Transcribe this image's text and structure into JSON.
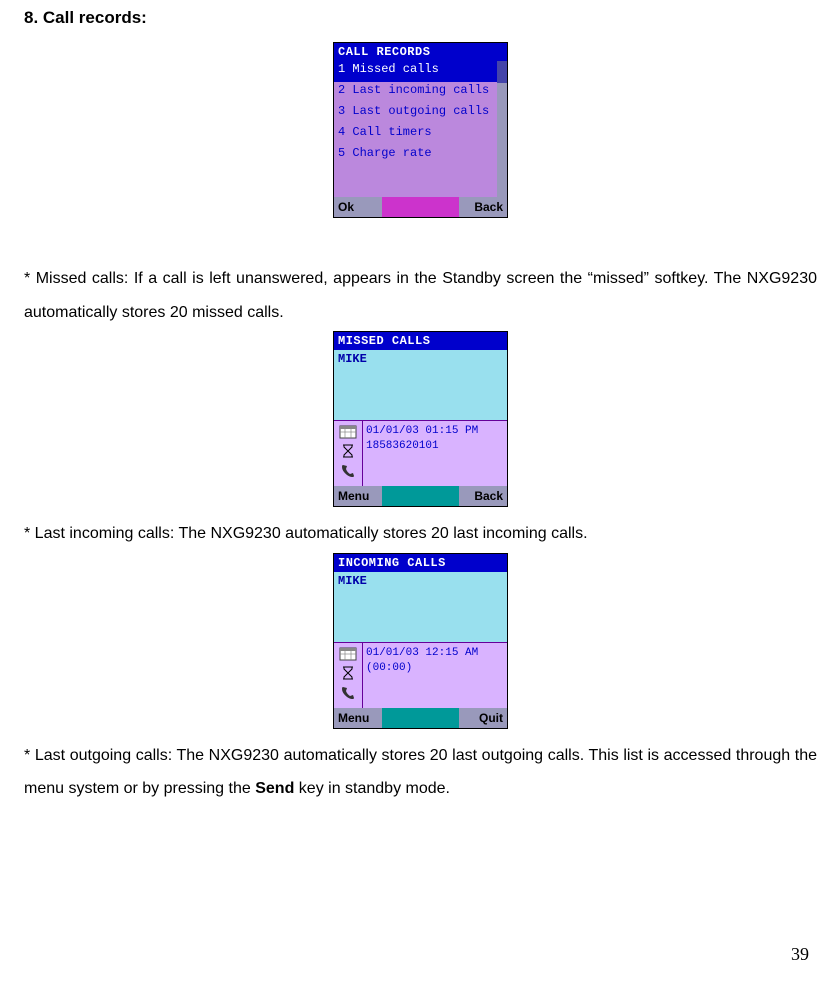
{
  "heading": "8. Call records:",
  "screen1": {
    "title": "CALL RECORDS",
    "items": [
      "1 Missed calls",
      "2 Last incoming calls",
      "3 Last outgoing calls",
      "4 Call timers",
      "5 Charge rate"
    ],
    "softLeft": "Ok",
    "softRight": "Back"
  },
  "para1_part1": "* Missed calls: If a call is left unanswered, appears in the Standby screen the “missed” softkey. The NXG9230 automatically stores 20 missed calls.",
  "screen2": {
    "title": "MISSED CALLS",
    "caller": "MIKE",
    "line1": "01/01/03 01:15 PM",
    "line2": "18583620101",
    "softLeft": "Menu",
    "softRight": "Back"
  },
  "para2": "* Last incoming calls: The NXG9230 automatically stores 20 last incoming calls.",
  "screen3": {
    "title": "INCOMING CALLS",
    "caller": "MIKE",
    "line1": "01/01/03 12:15 AM",
    "line2": "(00:00)",
    "softLeft": "Menu",
    "softRight": "Quit"
  },
  "para3_a": "* Last outgoing calls: The NXG9230 automatically stores 20 last outgoing calls. This list is accessed through the menu system or by pressing the ",
  "para3_b": "Send",
  "para3_c": " key in standby mode.",
  "pageNumber": "39"
}
